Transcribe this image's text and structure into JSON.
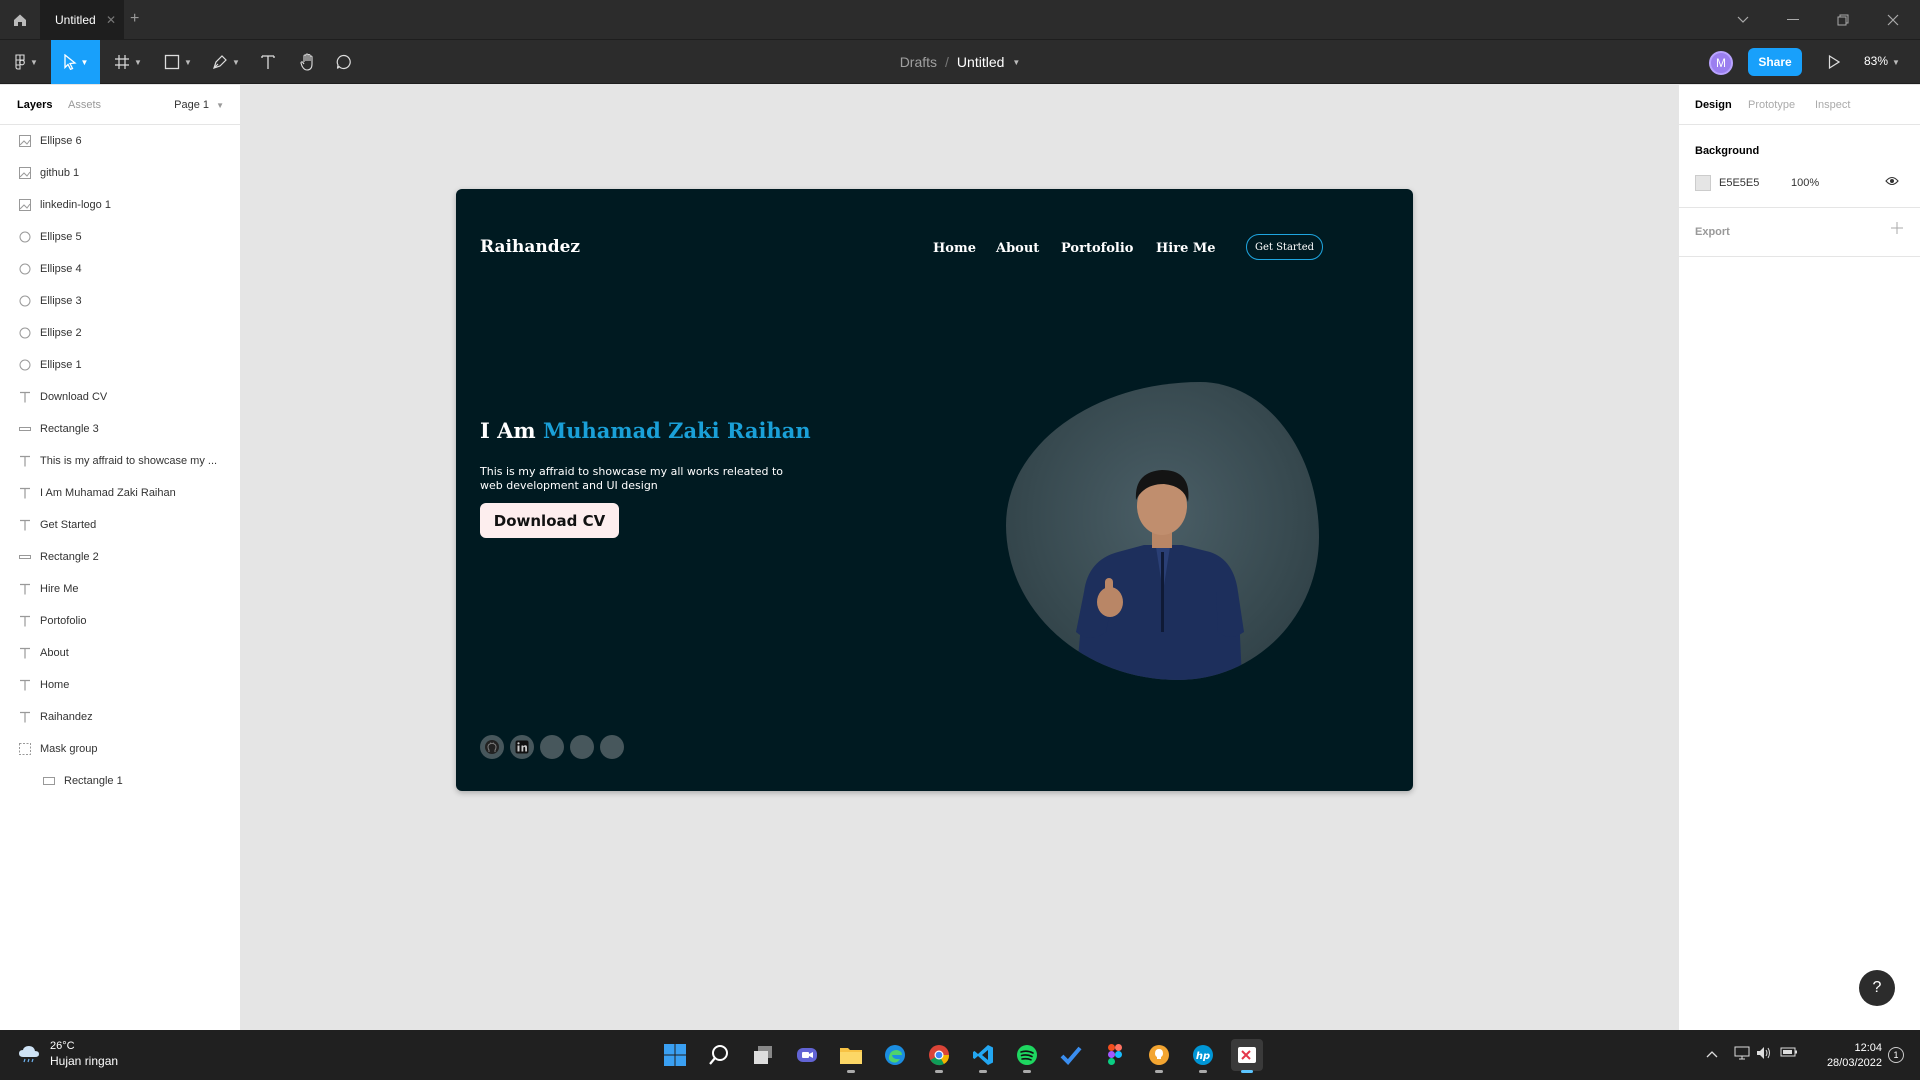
{
  "tabbar": {
    "tab_title": "Untitled",
    "close_glyph": "✕",
    "add_glyph": "+"
  },
  "toolbar": {
    "breadcrumb_root": "Drafts",
    "breadcrumb_sep": "/",
    "file_title": "Untitled",
    "avatar_initial": "M",
    "share_label": "Share",
    "zoom_label": "83%"
  },
  "layers_panel": {
    "tabs": [
      "Layers",
      "Assets"
    ],
    "page_label": "Page 1",
    "layers": [
      {
        "name": "Ellipse 6",
        "icon": "image-icon"
      },
      {
        "name": "github 1",
        "icon": "image-icon"
      },
      {
        "name": "linkedin-logo 1",
        "icon": "image-icon"
      },
      {
        "name": "Ellipse 5",
        "icon": "ellipse-icon"
      },
      {
        "name": "Ellipse 4",
        "icon": "ellipse-icon"
      },
      {
        "name": "Ellipse 3",
        "icon": "ellipse-icon"
      },
      {
        "name": "Ellipse 2",
        "icon": "ellipse-icon"
      },
      {
        "name": "Ellipse 1",
        "icon": "ellipse-icon"
      },
      {
        "name": "Download CV",
        "icon": "text-icon"
      },
      {
        "name": "Rectangle 3",
        "icon": "line-rect-icon"
      },
      {
        "name": "This is my affraid to showcase my ...",
        "icon": "text-icon"
      },
      {
        "name": "I Am Muhamad Zaki Raihan",
        "icon": "text-icon"
      },
      {
        "name": "Get Started",
        "icon": "text-icon"
      },
      {
        "name": "Rectangle 2",
        "icon": "line-rect-icon"
      },
      {
        "name": "Hire Me",
        "icon": "text-icon"
      },
      {
        "name": "Portofolio",
        "icon": "text-icon"
      },
      {
        "name": "About",
        "icon": "text-icon"
      },
      {
        "name": "Home",
        "icon": "text-icon"
      },
      {
        "name": "Raihandez",
        "icon": "text-icon"
      },
      {
        "name": "Mask group",
        "icon": "mask-icon"
      },
      {
        "name": "Rectangle 1",
        "icon": "rectangle-icon",
        "child": true
      }
    ]
  },
  "design": {
    "brand": "Raihandez",
    "nav": [
      "Home",
      "About",
      "Portofolio",
      "Hire Me"
    ],
    "cta_small": "Get Started",
    "hero_prefix": "I Am ",
    "hero_name": "Muhamad Zaki Raihan",
    "hero_desc": "This is my affraid to showcase my all works releated to web development and UI design",
    "cta_main": "Download CV",
    "colors": {
      "frame_bg": "#001a21",
      "accent": "#1aa0d8",
      "button_bg": "#fdeeee"
    }
  },
  "inspector": {
    "tabs": [
      "Design",
      "Prototype",
      "Inspect"
    ],
    "background_heading": "Background",
    "bg_hex": "E5E5E5",
    "bg_opacity": "100%",
    "export_heading": "Export"
  },
  "help_label": "?",
  "taskbar": {
    "temp": "26°C",
    "condition": "Hujan ringan",
    "time": "12:04",
    "date": "28/03/2022",
    "notification_count": "1"
  }
}
